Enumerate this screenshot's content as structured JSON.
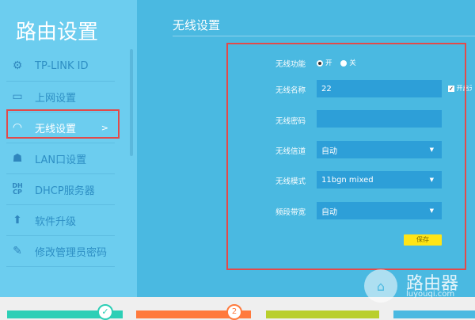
{
  "sidebar": {
    "title": "路由设置",
    "items": [
      {
        "label": "TP-LINK ID",
        "icon": "gear-icon"
      },
      {
        "label": "上网设置",
        "icon": "laptop-icon"
      },
      {
        "label": "无线设置",
        "icon": "wifi-icon",
        "arrow": ">"
      },
      {
        "label": "LAN口设置",
        "icon": "network-icon"
      },
      {
        "label": "DHCP服务器",
        "icon": "dhcp-icon"
      },
      {
        "label": "软件升级",
        "icon": "upload-icon"
      },
      {
        "label": "修改管理员密码",
        "icon": "pencil-icon"
      }
    ]
  },
  "main": {
    "title": "无线设置",
    "wireless_function": {
      "label": "无线功能",
      "on": "开",
      "off": "关",
      "selected": "开"
    },
    "ssid": {
      "label": "无线名称",
      "value": "22",
      "broadcast_label": "开启无线广播",
      "broadcast_checked": true
    },
    "password": {
      "label": "无线密码",
      "value": ""
    },
    "channel": {
      "label": "无线信道",
      "value": "自动"
    },
    "mode": {
      "label": "无线模式",
      "value": "11bgn mixed"
    },
    "bandwidth": {
      "label": "频段带宽",
      "value": "自动"
    },
    "save": "保存"
  },
  "bottom": {
    "step_badge": "2"
  },
  "watermark": {
    "name": "路由器",
    "url": "luyouqi.com"
  },
  "colors": {
    "highlight": "#e24a4a",
    "save": "#ffe516"
  }
}
